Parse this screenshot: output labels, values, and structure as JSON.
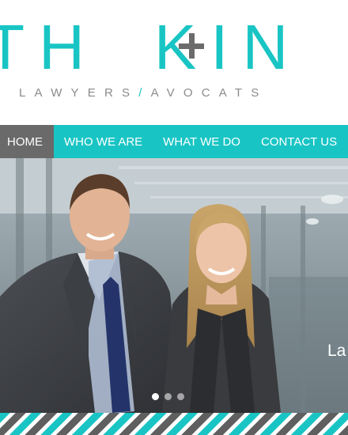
{
  "logo": {
    "left_text": "ITH",
    "right_text": "KIN",
    "tagline_left": "LAWYERS",
    "tagline_slash": "/",
    "tagline_right": "AVOCATS"
  },
  "nav": {
    "items": [
      {
        "label": "HOME"
      },
      {
        "label": "WHO WE ARE"
      },
      {
        "label": "WHAT WE DO"
      },
      {
        "label": "CONTACT US"
      }
    ]
  },
  "hero": {
    "caption": "La",
    "slides": 3,
    "active_slide": 1
  },
  "colors": {
    "brand_teal": "#19c5c4",
    "grey": "#6a6a6a"
  }
}
